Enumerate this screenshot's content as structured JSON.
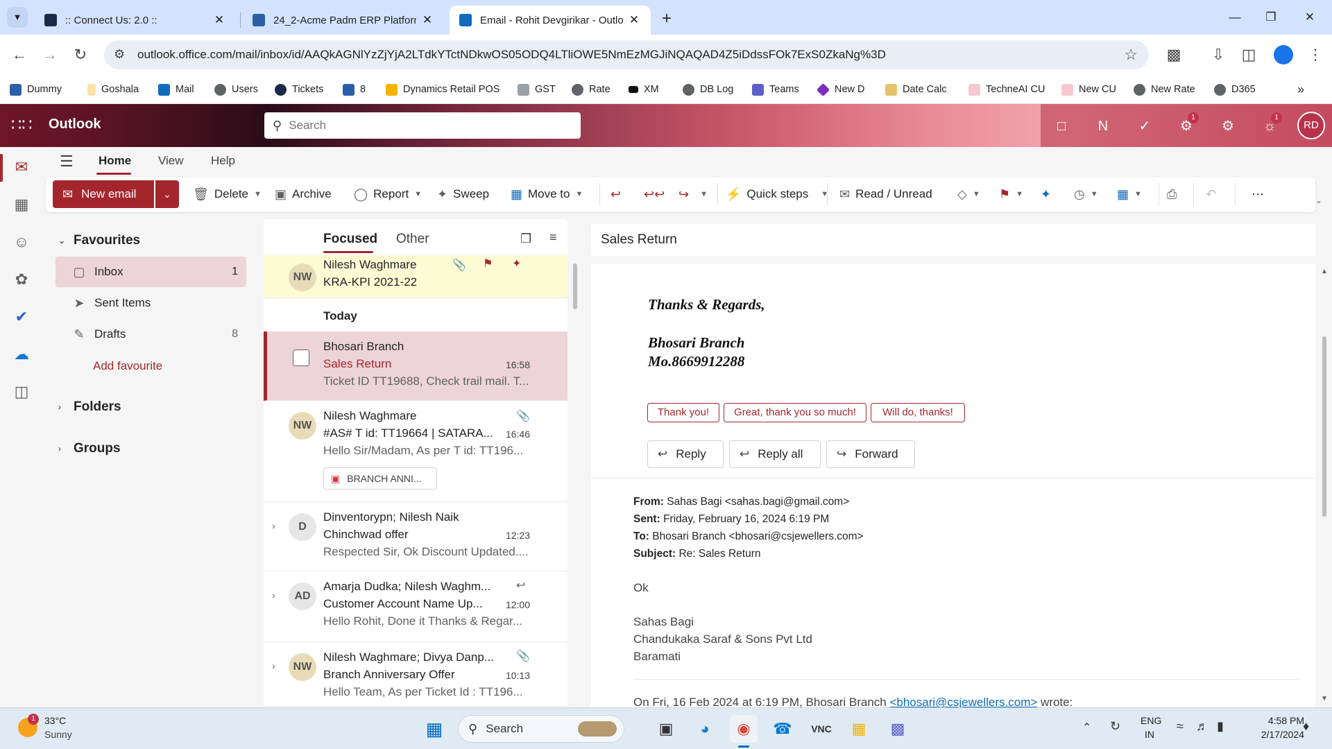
{
  "browser": {
    "tabs": [
      {
        "title": ":: Connect Us: 2.0 ::",
        "active": false
      },
      {
        "title": "24_2-Acme Padm ERP Platform",
        "active": false
      },
      {
        "title": "Email - Rohit Devgirikar - Outlo",
        "active": true
      }
    ],
    "url": "outlook.office.com/mail/inbox/id/AAQkAGNlYzZjYjA2LTdkYTctNDkwOS05ODQ4LTliOWE5NmEzMGJiNQAQAD4Z5iDdssFOk7ExS0ZkaNg%3D",
    "bookmarks": [
      "Dummy",
      "Goshala",
      "Mail",
      "Users",
      "Tickets",
      "8",
      "Dynamics Retail POS",
      "GST",
      "Rate",
      "XM",
      "DB Log",
      "Teams",
      "New D",
      "Date Calc",
      "TechneAI CU",
      "New CU",
      "New Rate",
      "D365"
    ]
  },
  "outlook": {
    "app_title": "Outlook",
    "search_placeholder": "Search",
    "notification_count": "1",
    "tips_count": "1",
    "avatar_initials": "RD",
    "accent": "#a4262c"
  },
  "ribbon": {
    "tabs": [
      "Home",
      "View",
      "Help"
    ],
    "new_email": "New email",
    "delete": "Delete",
    "archive": "Archive",
    "report": "Report",
    "sweep": "Sweep",
    "move_to": "Move to",
    "quick_steps": "Quick steps",
    "read_unread": "Read / Unread"
  },
  "folders": {
    "favourites": "Favourites",
    "inbox": "Inbox",
    "inbox_count": "1",
    "sent": "Sent Items",
    "drafts": "Drafts",
    "drafts_count": "8",
    "add_favourite": "Add favourite",
    "folders": "Folders",
    "groups": "Groups"
  },
  "list": {
    "focused": "Focused",
    "other": "Other",
    "today": "Today",
    "mails": [
      {
        "initials": "NW",
        "sender": "Nilesh Waghmare",
        "subject": "KRA-KPI 2021-22",
        "preview": "",
        "time": ""
      },
      {
        "initials": "",
        "sender": "Bhosari Branch",
        "subject": "Sales Return",
        "preview": "Ticket ID TT19688, Check trail mail. T...",
        "time": "16:58"
      },
      {
        "initials": "NW",
        "sender": "Nilesh Waghmare",
        "subject": "#AS# T id: TT19664 | SATARA...",
        "preview": "Hello Sir/Madam, As per T id: TT196...",
        "time": "16:46",
        "attachment": "BRANCH ANNI..."
      },
      {
        "initials": "D",
        "sender": "Dinventorypn; Nilesh Naik",
        "subject": "Chinchwad offer",
        "preview": "Respected Sir, Ok Discount Updated....",
        "time": "12:23"
      },
      {
        "initials": "AD",
        "sender": "Amarja Dudka; Nilesh Waghm...",
        "subject": "Customer Account Name Up...",
        "preview": "Hello Rohit, Done it Thanks & Regar...",
        "time": "12:00"
      },
      {
        "initials": "NW",
        "sender": "Nilesh Waghmare; Divya Danp...",
        "subject": "Branch Anniversary Offer",
        "preview": "Hello Team, As per Ticket Id : TT196...",
        "time": "10:13"
      }
    ]
  },
  "reading": {
    "subject": "Sales Return",
    "sig_regards": "Thanks & Regards,",
    "sig_branch": "Bhosari Branch",
    "sig_mobile": "Mo.8669912288",
    "suggested": [
      "Thank you!",
      "Great, thank you so much!",
      "Will do, thanks!"
    ],
    "reply": "Reply",
    "reply_all": "Reply all",
    "forward": "Forward",
    "from_label": "From:",
    "from": "Sahas Bagi <sahas.bagi@gmail.com>",
    "sent_label": "Sent:",
    "sent": "Friday, February 16, 2024 6:19 PM",
    "to_label": "To:",
    "to": "Bhosari Branch <bhosari@csjewellers.com>",
    "subject_label": "Subject:",
    "subject_line": "Re: Sales Return",
    "body_ok": "Ok",
    "sender_name": "Sahas Bagi",
    "sender_company": "Chandukaka Saraf & Sons Pvt Ltd",
    "sender_city": "Baramati",
    "quote_intro": "On Fri, 16 Feb 2024 at 6:19 PM, Bhosari Branch ",
    "quote_email": "<bhosari@csjewellers.com>",
    "quote_tail": " wrote:"
  },
  "taskbar": {
    "weather_temp": "33°C",
    "weather_desc": "Sunny",
    "weather_badge": "1",
    "search": "Search",
    "lang": "ENG",
    "region": "IN",
    "time": "4:58 PM",
    "date": "2/17/2024"
  }
}
